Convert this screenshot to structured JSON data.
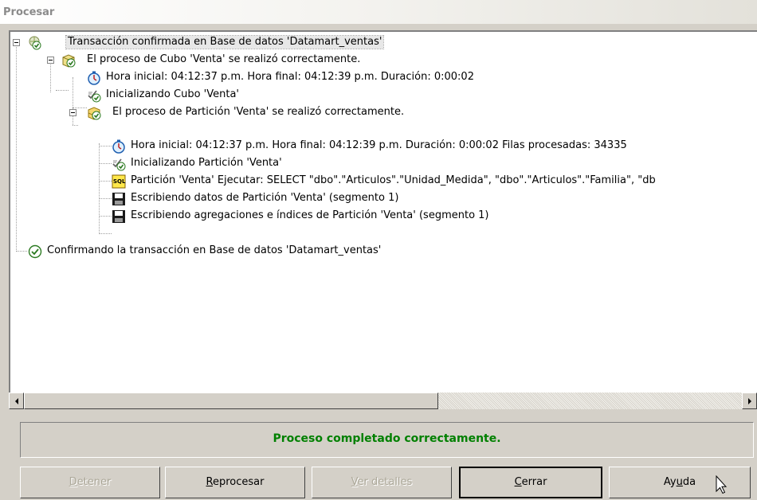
{
  "window": {
    "title": "Procesar"
  },
  "tree": {
    "nodes": [
      {
        "label": "Transacción confirmada en Base de datos 'Datamart_ventas'",
        "icon": "transaction-check-icon"
      },
      {
        "label": "El proceso de Cubo 'Venta' se realizó correctamente.",
        "icon": "cube-check-icon"
      },
      {
        "label": "Hora inicial: 04:12:37 p.m.  Hora final: 04:12:39 p.m.  Duración: 0:00:02",
        "icon": "stopwatch-icon"
      },
      {
        "label": "Inicializando Cubo 'Venta'",
        "icon": "initialize-check-icon"
      },
      {
        "label": "El proceso de Partición 'Venta' se realizó correctamente.",
        "icon": "partition-check-icon"
      },
      {
        "label": "Hora inicial: 04:12:37 p.m.  Hora final: 04:12:39 p.m.  Duración: 0:00:02  Filas procesadas: 34335",
        "icon": "stopwatch-icon"
      },
      {
        "label": "Inicializando Partición 'Venta'",
        "icon": "initialize-check-icon"
      },
      {
        "label": "Partición 'Venta' Ejecutar: SELECT \"dbo\".\"Articulos\".\"Unidad_Medida\", \"dbo\".\"Articulos\".\"Familia\", \"db",
        "icon": "sql-icon"
      },
      {
        "label": "Escribiendo datos de Partición 'Venta' (segmento  1)",
        "icon": "floppy-disk-icon"
      },
      {
        "label": "Escribiendo agregaciones e índices de Partición 'Venta' (segmento  1)",
        "icon": "floppy-disk-icon"
      },
      {
        "label": "Confirmando la transacción en Base de datos 'Datamart_ventas'",
        "icon": "check-circle-icon"
      }
    ]
  },
  "status": {
    "message": "Proceso completado correctamente."
  },
  "buttons": {
    "stop": {
      "label": "Detener",
      "accesskey": "D"
    },
    "reprocess": {
      "label": "Reprocesar",
      "accesskey": "R"
    },
    "details": {
      "label": "Ver detalles",
      "accesskey": "V"
    },
    "close": {
      "label": "Cerrar",
      "accesskey": "C"
    },
    "help": {
      "label": "Ayuda",
      "accesskey": "u"
    }
  },
  "colors": {
    "status_text": "#008000",
    "dialog_bg": "#d4d0c8",
    "disabled_text": "#aca899"
  }
}
